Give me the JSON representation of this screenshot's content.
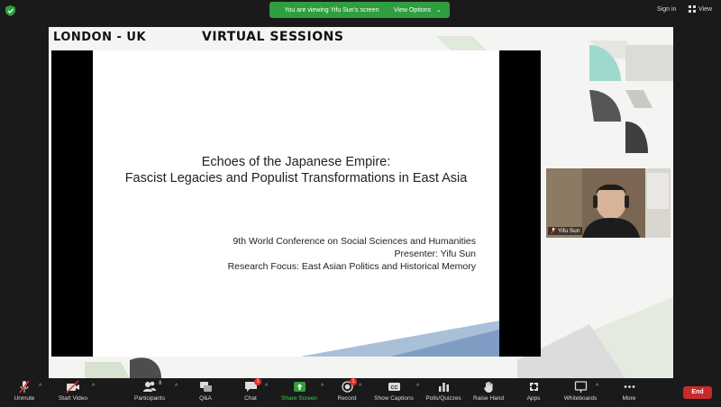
{
  "topbar": {
    "viewing_banner": "You are viewing Yifu Sun's screen",
    "view_options_label": "View Options",
    "sign_in_label": "Sign in",
    "view_label": "View"
  },
  "shared_screen": {
    "header_city": "LONDON - UK",
    "header_sessions": "VIRTUAL SESSIONS",
    "slide": {
      "title_line1": "Echoes of the Japanese Empire:",
      "title_line2": "Fascist Legacies and Populist Transformations in East Asia",
      "conference": "9th World Conference on Social Sciences and Humanities",
      "presenter": "Presenter: Yifu Sun",
      "research_focus": "Research Focus: East Asian Politics and Historical Memory"
    }
  },
  "video_tile": {
    "name": "Yifu Sun"
  },
  "toolbar": {
    "unmute": "Unmute",
    "start_video": "Start Video",
    "participants": "Participants",
    "participants_count": "8",
    "qa": "Q&A",
    "chat": "Chat",
    "chat_badge": "1",
    "share_screen": "Share Screen",
    "record": "Record",
    "record_badge": "1",
    "show_captions": "Show Captions",
    "polls": "Polls/Quizzes",
    "raise_hand": "Raise Hand",
    "apps": "Apps",
    "whiteboards": "Whiteboards",
    "more": "More",
    "end": "End"
  },
  "colors": {
    "share_green": "#2e9e3f",
    "end_red": "#c72a2a",
    "toolbar_bg": "#1a1a1a"
  }
}
